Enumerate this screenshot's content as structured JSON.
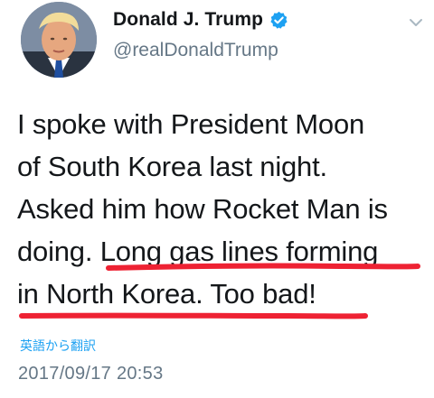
{
  "author": {
    "display_name": "Donald J. Trump",
    "handle": "@realDonaldTrump",
    "verified": true,
    "avatar_icon": "profile-photo"
  },
  "tweet": {
    "lines": [
      "I spoke with President Moon",
      "of South Korea last night.",
      "Asked him how Rocket Man is",
      "doing. ",
      "Long gas lines forming",
      "in North Korea. Too bad!"
    ]
  },
  "translate_link": "英語から翻訳",
  "timestamp": "2017/09/17 20:53",
  "colors": {
    "link_blue": "#1da1f2",
    "muted_gray": "#657786",
    "underline_red": "#ee2233"
  }
}
